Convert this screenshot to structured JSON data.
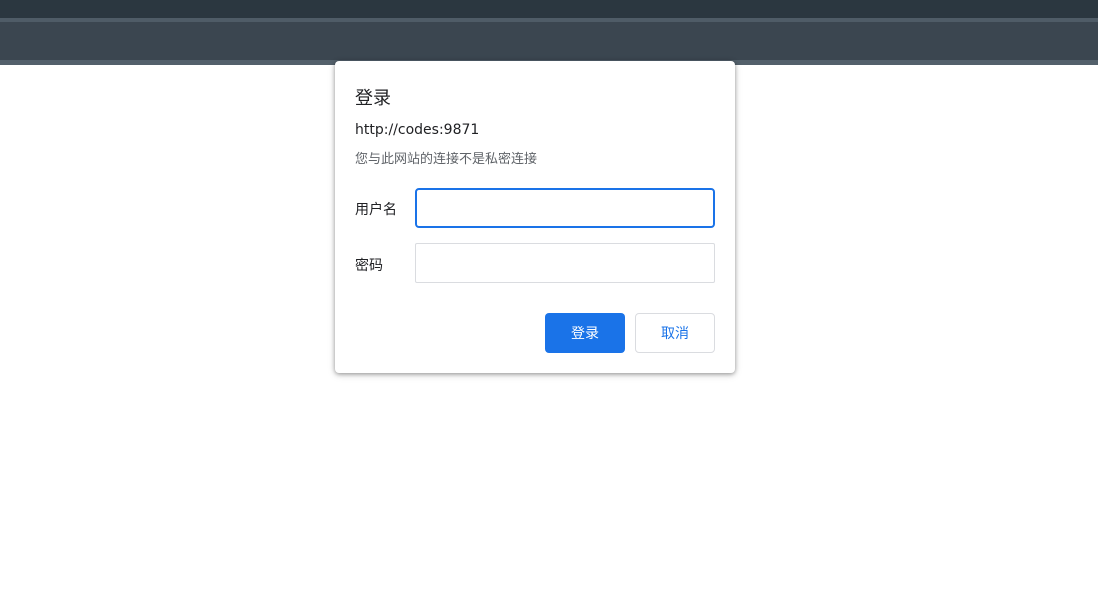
{
  "dialog": {
    "title": "登录",
    "origin": "http://codes:9871",
    "warning": "您与此网站的连接不是私密连接",
    "username_label": "用户名",
    "username_value": "",
    "password_label": "密码",
    "password_value": "",
    "login_label": "登录",
    "cancel_label": "取消"
  },
  "colors": {
    "accent": "#1a73e8",
    "page_background": "#ffffff",
    "topbar": "#3b4650"
  }
}
